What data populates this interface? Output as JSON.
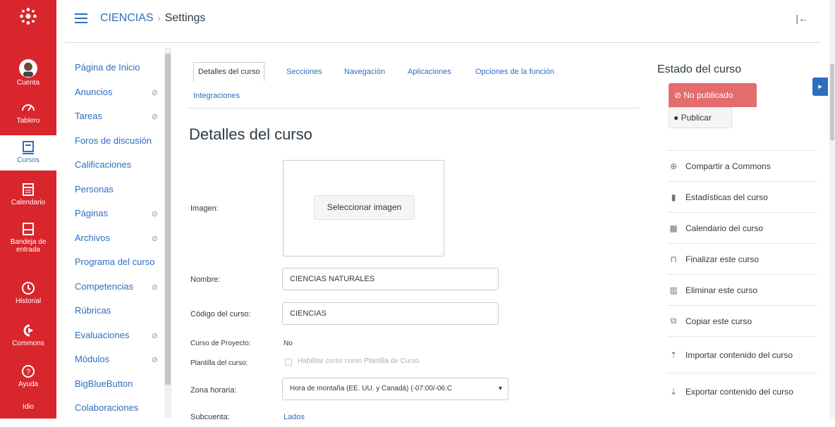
{
  "global_nav": {
    "items": [
      {
        "label": "Cuenta",
        "icon": "user-avatar-icon"
      },
      {
        "label": "Tablero",
        "icon": "dashboard-icon"
      },
      {
        "label": "Cursos",
        "icon": "courses-icon",
        "active": true
      },
      {
        "label": "Calendario",
        "icon": "calendar-icon"
      },
      {
        "label": "Bandeja de entrada",
        "icon": "inbox-icon"
      },
      {
        "label": "Historial",
        "icon": "history-icon"
      },
      {
        "label": "Commons",
        "icon": "commons-icon"
      },
      {
        "label": "Ayuda",
        "icon": "help-icon"
      },
      {
        "label": "Idio",
        "icon": "language-icon"
      }
    ]
  },
  "breadcrumb": {
    "course": "CIENCIAS",
    "separator": "›",
    "page": "Settings"
  },
  "course_nav": [
    {
      "label": "Página de Inicio",
      "hidden": false
    },
    {
      "label": "Anuncios",
      "hidden": true
    },
    {
      "label": "Tareas",
      "hidden": true
    },
    {
      "label": "Foros de discusión",
      "hidden": false
    },
    {
      "label": "Calificaciones",
      "hidden": false
    },
    {
      "label": "Personas",
      "hidden": false
    },
    {
      "label": "Páginas",
      "hidden": true
    },
    {
      "label": "Archivos",
      "hidden": true
    },
    {
      "label": "Programa del curso",
      "hidden": false
    },
    {
      "label": "Competencias",
      "hidden": true
    },
    {
      "label": "Rúbricas",
      "hidden": false
    },
    {
      "label": "Evaluaciones",
      "hidden": true
    },
    {
      "label": "Módulos",
      "hidden": true
    },
    {
      "label": "BigBlueButton",
      "hidden": false
    },
    {
      "label": "Colaboraciones",
      "hidden": false
    }
  ],
  "tabs": {
    "detalles": "Detalles del curso",
    "secciones": "Secciones",
    "navegacion": "Navegación",
    "aplicaciones": "Aplicaciones",
    "opciones": "Opciones de la función",
    "integraciones": "Integraciones"
  },
  "page_title": "Detalles del curso",
  "form": {
    "imagen_label": "Imagen:",
    "seleccionar_imagen": "Seleccionar imagen",
    "nombre_label": "Nombre:",
    "nombre_value": "CIENCIAS NATURALES",
    "codigo_label": "Código del curso:",
    "codigo_value": "CIENCIAS",
    "proyecto_label": "Curso de Proyecto:",
    "proyecto_value": "No",
    "plantilla_label": "Plantilla del curso:",
    "plantilla_checkbox": "Habilitar curso como Plantilla de Curso",
    "zona_label": "Zona horaria:",
    "zona_value": "Hora de montaña (EE. UU. y Canadá) (-07:00/-06:C",
    "subcuenta_label": "Subcuenta:",
    "subcuenta_value": "Lados"
  },
  "sidebar": {
    "estado_title": "Estado del curso",
    "no_publicado": "No publicado",
    "publicar": "Publicar",
    "actions": [
      {
        "label": "Compartir a Commons",
        "icon": "share-icon"
      },
      {
        "label": "Estadísticas del curso",
        "icon": "bar-chart-icon"
      },
      {
        "label": "Calendario del curso",
        "icon": "calendar-icon"
      },
      {
        "label": "Finalizar este curso",
        "icon": "lock-icon"
      },
      {
        "label": "Eliminar este curso",
        "icon": "trash-icon"
      },
      {
        "label": "Copiar este curso",
        "icon": "copy-icon"
      },
      {
        "label": "Importar contenido del curso",
        "icon": "import-icon"
      },
      {
        "label": "Exportar contenido del curso",
        "icon": "export-icon"
      }
    ]
  },
  "colors": {
    "brand_red": "#d9262d",
    "link_blue": "#2d6ebf",
    "unpublished": "#e46c6c"
  }
}
